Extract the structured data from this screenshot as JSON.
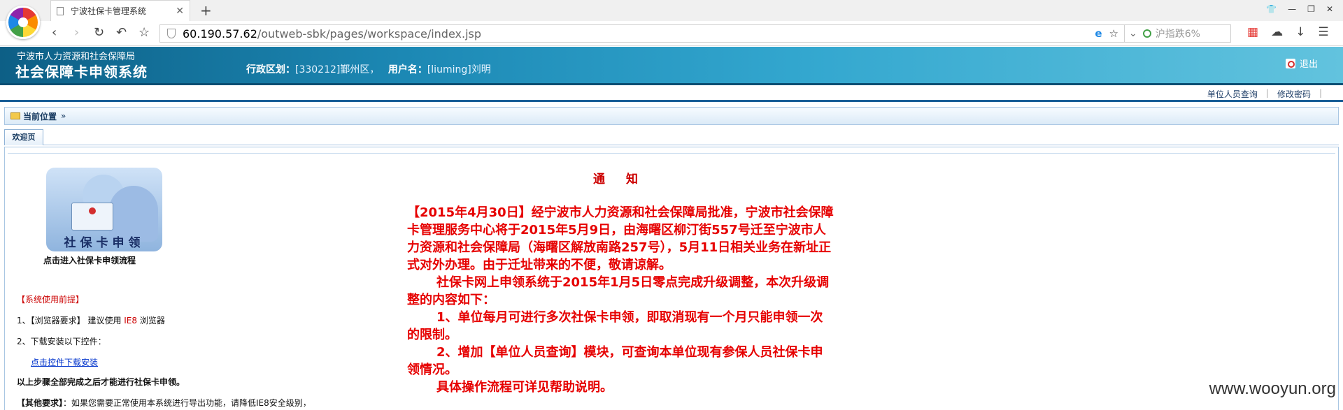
{
  "browser": {
    "tab_title": "宁波社保卡管理系统",
    "url_host": "60.190.57.62",
    "url_path": "/outweb-sbk/pages/workspace/index.jsp",
    "search_placeholder": "沪指跌6%"
  },
  "header": {
    "agency": "宁波市人力资源和社会保障局",
    "system_name": "社会保障卡申领系统",
    "district_label": "行政区划：",
    "district_value": "[330212]鄞州区，",
    "user_label": "用户名：",
    "user_value": "[liuming]刘明",
    "logout_label": "退出"
  },
  "links": {
    "staff_query": "单位人员查询",
    "change_password": "修改密码"
  },
  "breadcrumb": {
    "label": "当前位置",
    "arrows": "»"
  },
  "tabs": {
    "welcome": "欢迎页"
  },
  "left": {
    "flow_image_text": "社保卡申领",
    "flow_link": "点击进入社保卡申领流程",
    "prereq_title": "【系统使用前提】",
    "browser_req_prefix": "1、【浏览器要求】 建议使用 ",
    "browser_req_ie": "IE8",
    "browser_req_suffix": " 浏览器",
    "download_req": "2、下载安装以下控件：",
    "download_link": "点击控件下载安装",
    "complete_note": "以上步骤全部完成之后才能进行社保卡申领。",
    "other_req_label": "【其他要求】",
    "other_req_text": "：如果您需要正常使用本系统进行导出功能，请降低IE8安全级别，"
  },
  "notice": {
    "title": "通知",
    "p1": "【2015年4月30日】经宁波市人力资源和社会保障局批准，宁波市社会保障卡管理服务中心将于2015年5月9日，由海曙区柳汀街557号迁至宁波市人力资源和社会保障局（海曙区解放南路257号），5月11日相关业务在新址正式对外办理。由于迁址带来的不便，敬请谅解。",
    "p2": "社保卡网上申领系统于2015年1月5日零点完成升级调整，本次升级调整的内容如下：",
    "p3": "1、单位每月可进行多次社保卡申领，即取消现有一个月只能申领一次的限制。",
    "p4": "2、增加【单位人员查询】模块，可查询本单位现有参保人员社保卡申领情况。",
    "p5": "具体操作流程可详见帮助说明。"
  },
  "watermark": "www.wooyun.org"
}
